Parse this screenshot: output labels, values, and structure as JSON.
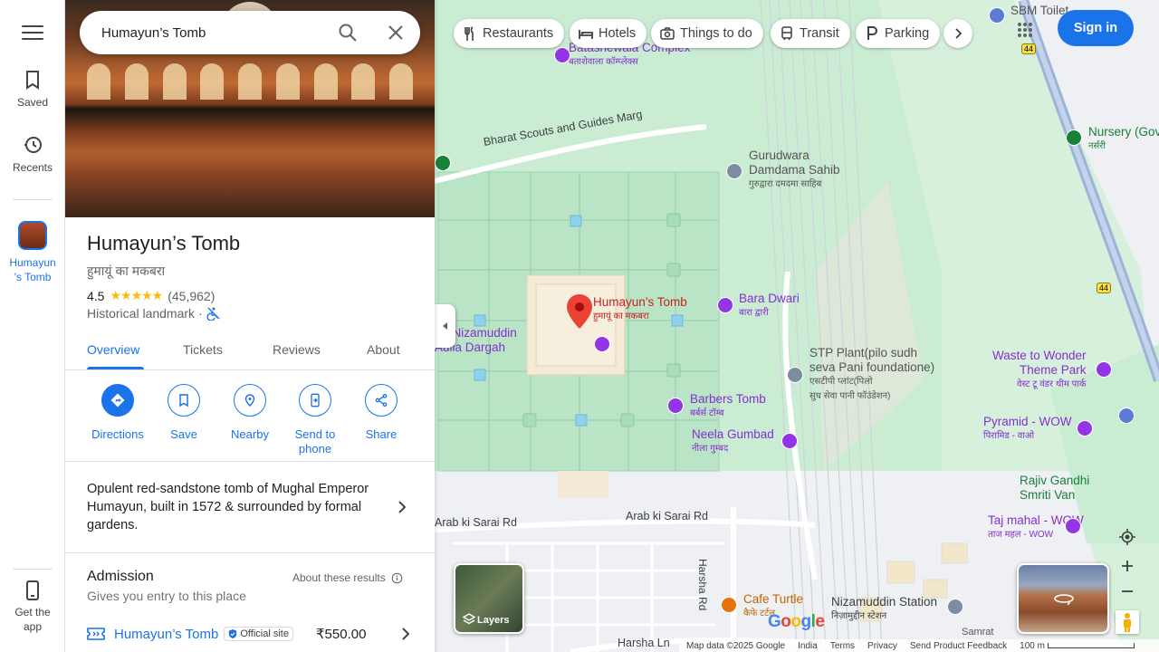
{
  "rail": {
    "saved": "Saved",
    "recents": "Recents",
    "active_place_line1": "Humayun",
    "active_place_line2": "’s Tomb",
    "get_app_line1": "Get the",
    "get_app_line2": "app"
  },
  "search": {
    "value": "Humayun’s Tomb"
  },
  "place": {
    "name": "Humayun’s Tomb",
    "native_name": "हुमायूं का मकबरा",
    "rating": "4.5",
    "stars": "★★★★★",
    "reviews_count": "(45,962)",
    "category": "Historical landmark",
    "category_sep": "·"
  },
  "tabs": [
    "Overview",
    "Tickets",
    "Reviews",
    "About"
  ],
  "actions": {
    "directions": "Directions",
    "save": "Save",
    "nearby": "Nearby",
    "send_line1": "Send to",
    "send_line2": "phone",
    "share": "Share"
  },
  "description": "Opulent red-sandstone tomb of Mughal Emperor Humayun, built in 1572 & surrounded by formal gardens.",
  "admission": {
    "title": "Admission",
    "about": "About these results",
    "subtitle": "Gives you entry to this place",
    "ticket_name": "Humayun’s Tomb",
    "badge": "Official site",
    "price": "₹550.00"
  },
  "map": {
    "chips": [
      "Restaurants",
      "Hotels",
      "Things to do",
      "Transit",
      "Parking"
    ],
    "sign_in": "Sign in",
    "layers": "Layers",
    "labels": {
      "batashewala": "Batashewala Complex",
      "batashewala_hi": "बताशेवाला कॉम्प्लेक्स",
      "sbm_toilet": "SBM Toilet",
      "road_bharat": "Bharat Scouts and Guides Marg",
      "gurudwara": "Gurudwara",
      "gurudwara2": "Damdama Sahib",
      "gurudwara_hi": "गुरुद्वारा दमदमा साहिब",
      "nursery": "Nursery (Gov",
      "nursery_hi": "नर्सरी",
      "humayun_pin": "Humayun’s Tomb",
      "humayun_pin_hi": "हुमायूं का मकबरा",
      "bara_dwari": "Bara Dwari",
      "bara_dwari_hi": "बारा द्वारी",
      "nizamuddin": "rat Nizamuddin",
      "nizamuddin2": "Aulia Dargah",
      "stp1": "STP Plant(pilo sudh",
      "stp2": "seva Pani foundatione)",
      "stp_hi1": "एसटीपी प्लांट(पिलो",
      "stp_hi2": "सुध सेवा पानी फॉउंडेशन)",
      "waste1": "Waste to Wonder",
      "waste2": "Theme Park",
      "waste_hi": "वेस्ट टू वंडर थीम पार्क",
      "barbers": "Barbers Tomb",
      "barbers_hi": "बर्बर्स टॉम्ब",
      "neela": "Neela Gumbad",
      "neela_hi": "नीला गुम्बद",
      "pyramid": "Pyramid - WOW",
      "pyramid_hi": "पिरामिड - वाओ",
      "rajiv1": "Rajiv Gandhi",
      "rajiv2": "Smriti Van",
      "taj": "Taj mahal - WOW",
      "taj_hi": "ताज महल - WOW",
      "arab1": "Arab ki Sarai Rd",
      "arab2": "Arab ki Sarai Rd",
      "harsha_rd": "Harsha Rd",
      "cafe": "Cafe Turtle",
      "cafe_hi": "कैफे टर्टल",
      "station": "Nizamuddin Station",
      "station_hi": "निज़ामुद्दीन स्टेशन",
      "samrat": "Samrat",
      "harsha_ln": "Harsha Ln",
      "route44a": "44",
      "route44b": "44"
    },
    "google": [
      "G",
      "o",
      "o",
      "g",
      "l",
      "e"
    ],
    "footer": {
      "data": "Map data ©2025 Google",
      "india": "India",
      "terms": "Terms",
      "privacy": "Privacy",
      "feedback": "Send Product Feedback",
      "scale": "100 m"
    },
    "colors": {
      "park": "#c9ecd3",
      "park_dark": "#b4e2c2",
      "road": "#ffffff",
      "highway": "#9db4d9",
      "accent": "#1a73e8",
      "poi_purple": "#9334e6",
      "pin_red": "#ea4335"
    }
  }
}
